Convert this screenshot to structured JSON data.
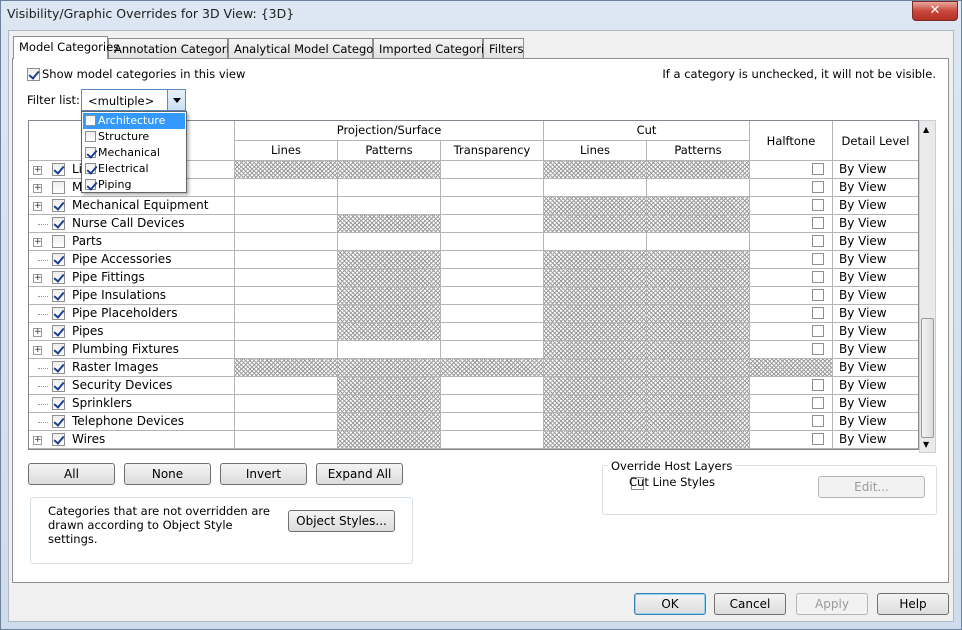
{
  "window": {
    "title": "Visibility/Graphic Overrides for 3D View: {3D}",
    "close_label": "✕"
  },
  "tabs": [
    "Model Categories",
    "Annotation Categories",
    "Analytical Model Categories",
    "Imported Categories",
    "Filters"
  ],
  "active_tab": "Model Categories",
  "show_categories": {
    "label": "Show model categories in this view",
    "checked": true
  },
  "hint": "If a category is unchecked, it will not be visible.",
  "filter": {
    "label": "Filter list:",
    "value": "<multiple>",
    "options": [
      {
        "label": "Architecture",
        "checked": false,
        "highlighted": true
      },
      {
        "label": "Structure",
        "checked": false,
        "highlighted": false
      },
      {
        "label": "Mechanical",
        "checked": true,
        "highlighted": false
      },
      {
        "label": "Electrical",
        "checked": true,
        "highlighted": false
      },
      {
        "label": "Piping",
        "checked": true,
        "highlighted": false
      }
    ]
  },
  "table": {
    "group_projection": "Projection/Surface",
    "group_cut": "Cut",
    "col_lines": "Lines",
    "col_patterns": "Patterns",
    "col_transparency": "Transparency",
    "col_cut_lines": "Lines",
    "col_cut_patterns": "Patterns",
    "col_halftone": "Halftone",
    "col_detail": "Detail Level",
    "rows": [
      {
        "name": "Lighting Fixtures",
        "visible_text": "Li",
        "expandable": true,
        "checked": true,
        "detail": "By View",
        "hatch": [
          0,
          1,
          1,
          0,
          1,
          1,
          0,
          0
        ],
        "halftone": true
      },
      {
        "name": "Mechanical Control Devices",
        "visible_text": "M",
        "expandable": true,
        "checked": false,
        "detail": "By View",
        "hatch": [
          0,
          0,
          0,
          0,
          0,
          0,
          0,
          0
        ],
        "halftone": true
      },
      {
        "name": "Mechanical Equipment",
        "visible_text": "Mechanical Equipment",
        "expandable": true,
        "checked": true,
        "detail": "By View",
        "hatch": [
          0,
          0,
          0,
          0,
          1,
          1,
          0,
          0
        ],
        "halftone": true
      },
      {
        "name": "Nurse Call Devices",
        "visible_text": "Nurse Call Devices",
        "expandable": false,
        "checked": true,
        "detail": "By View",
        "hatch": [
          0,
          0,
          1,
          0,
          1,
          1,
          0,
          0
        ],
        "halftone": true
      },
      {
        "name": "Parts",
        "visible_text": "Parts",
        "expandable": true,
        "checked": false,
        "detail": "By View",
        "hatch": [
          0,
          0,
          0,
          0,
          0,
          0,
          0,
          0
        ],
        "halftone": true
      },
      {
        "name": "Pipe Accessories",
        "visible_text": "Pipe Accessories",
        "expandable": false,
        "checked": true,
        "detail": "By View",
        "hatch": [
          0,
          0,
          1,
          0,
          1,
          1,
          0,
          0
        ],
        "halftone": true
      },
      {
        "name": "Pipe Fittings",
        "visible_text": "Pipe Fittings",
        "expandable": true,
        "checked": true,
        "detail": "By View",
        "hatch": [
          0,
          0,
          1,
          0,
          1,
          1,
          0,
          0
        ],
        "halftone": true
      },
      {
        "name": "Pipe Insulations",
        "visible_text": "Pipe Insulations",
        "expandable": false,
        "checked": true,
        "detail": "By View",
        "hatch": [
          0,
          0,
          1,
          0,
          1,
          1,
          0,
          0
        ],
        "halftone": true
      },
      {
        "name": "Pipe Placeholders",
        "visible_text": "Pipe Placeholders",
        "expandable": false,
        "checked": true,
        "detail": "By View",
        "hatch": [
          0,
          0,
          1,
          0,
          1,
          1,
          0,
          0
        ],
        "halftone": true
      },
      {
        "name": "Pipes",
        "visible_text": "Pipes",
        "expandable": true,
        "checked": true,
        "detail": "By View",
        "hatch": [
          0,
          0,
          1,
          0,
          1,
          1,
          0,
          0
        ],
        "halftone": true
      },
      {
        "name": "Plumbing Fixtures",
        "visible_text": "Plumbing Fixtures",
        "expandable": true,
        "checked": true,
        "detail": "By View",
        "hatch": [
          0,
          0,
          0,
          0,
          1,
          1,
          0,
          0
        ],
        "halftone": true
      },
      {
        "name": "Raster Images",
        "visible_text": "Raster Images",
        "expandable": false,
        "checked": true,
        "detail": "By View",
        "hatch": [
          0,
          1,
          1,
          1,
          1,
          1,
          1,
          0
        ],
        "halftone": false
      },
      {
        "name": "Security Devices",
        "visible_text": "Security Devices",
        "expandable": false,
        "checked": true,
        "detail": "By View",
        "hatch": [
          0,
          0,
          1,
          0,
          1,
          1,
          0,
          0
        ],
        "halftone": true
      },
      {
        "name": "Sprinklers",
        "visible_text": "Sprinklers",
        "expandable": false,
        "checked": true,
        "detail": "By View",
        "hatch": [
          0,
          0,
          1,
          0,
          1,
          1,
          0,
          0
        ],
        "halftone": true
      },
      {
        "name": "Telephone Devices",
        "visible_text": "Telephone Devices",
        "expandable": false,
        "checked": true,
        "detail": "By View",
        "hatch": [
          0,
          0,
          1,
          0,
          1,
          1,
          0,
          0
        ],
        "halftone": true
      },
      {
        "name": "Wires",
        "visible_text": "Wires",
        "expandable": true,
        "checked": true,
        "detail": "By View",
        "hatch": [
          0,
          0,
          1,
          0,
          1,
          1,
          0,
          0
        ],
        "halftone": true
      }
    ]
  },
  "buttons": {
    "all": "All",
    "none": "None",
    "invert": "Invert",
    "expand_all": "Expand All",
    "object_styles": "Object Styles...",
    "edit": "Edit...",
    "ok": "OK",
    "cancel": "Cancel",
    "apply": "Apply",
    "help": "Help"
  },
  "note": "Categories that are not overridden are drawn according to Object Style settings.",
  "override": {
    "title": "Override Host Layers",
    "cut_line_styles": "Cut Line Styles",
    "checked": false
  }
}
